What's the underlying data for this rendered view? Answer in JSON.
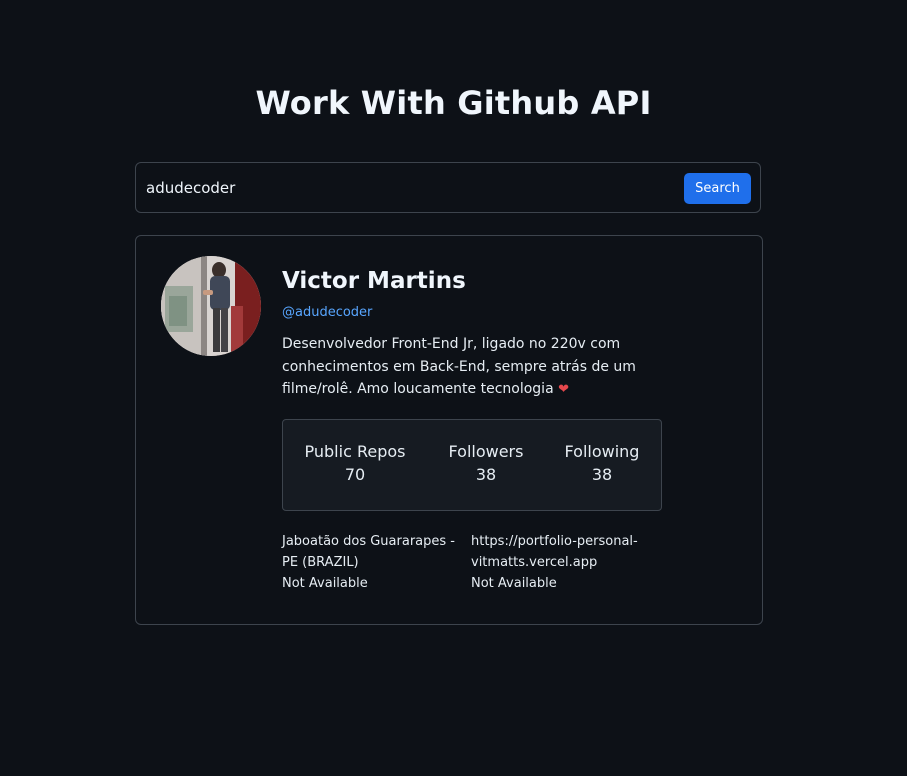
{
  "header": {
    "title": "Work With Github API"
  },
  "search": {
    "value": "adudecoder",
    "button_label": "Search"
  },
  "profile": {
    "name": "Victor Martins",
    "login": "@adudecoder",
    "bio": "Desenvolvedor Front-End Jr, ligado no 220v com conhecimentos em Back-End, sempre atrás de um filme/rolê. Amo loucamente tecnologia",
    "bio_emoji": "❤",
    "stats": {
      "repos_label": "Public Repos",
      "repos_value": "70",
      "followers_label": "Followers",
      "followers_value": "38",
      "following_label": "Following",
      "following_value": "38"
    },
    "location": "Jaboatão dos Guararapes - PE (BRAZIL)",
    "blog": "https://portfolio-personal-vitmatts.vercel.app",
    "twitter": "Not Available",
    "company": "Not Available"
  },
  "colors": {
    "background": "#0d1117",
    "accent": "#1f6feb",
    "link": "#58a6ff",
    "border": "#3d444d"
  }
}
